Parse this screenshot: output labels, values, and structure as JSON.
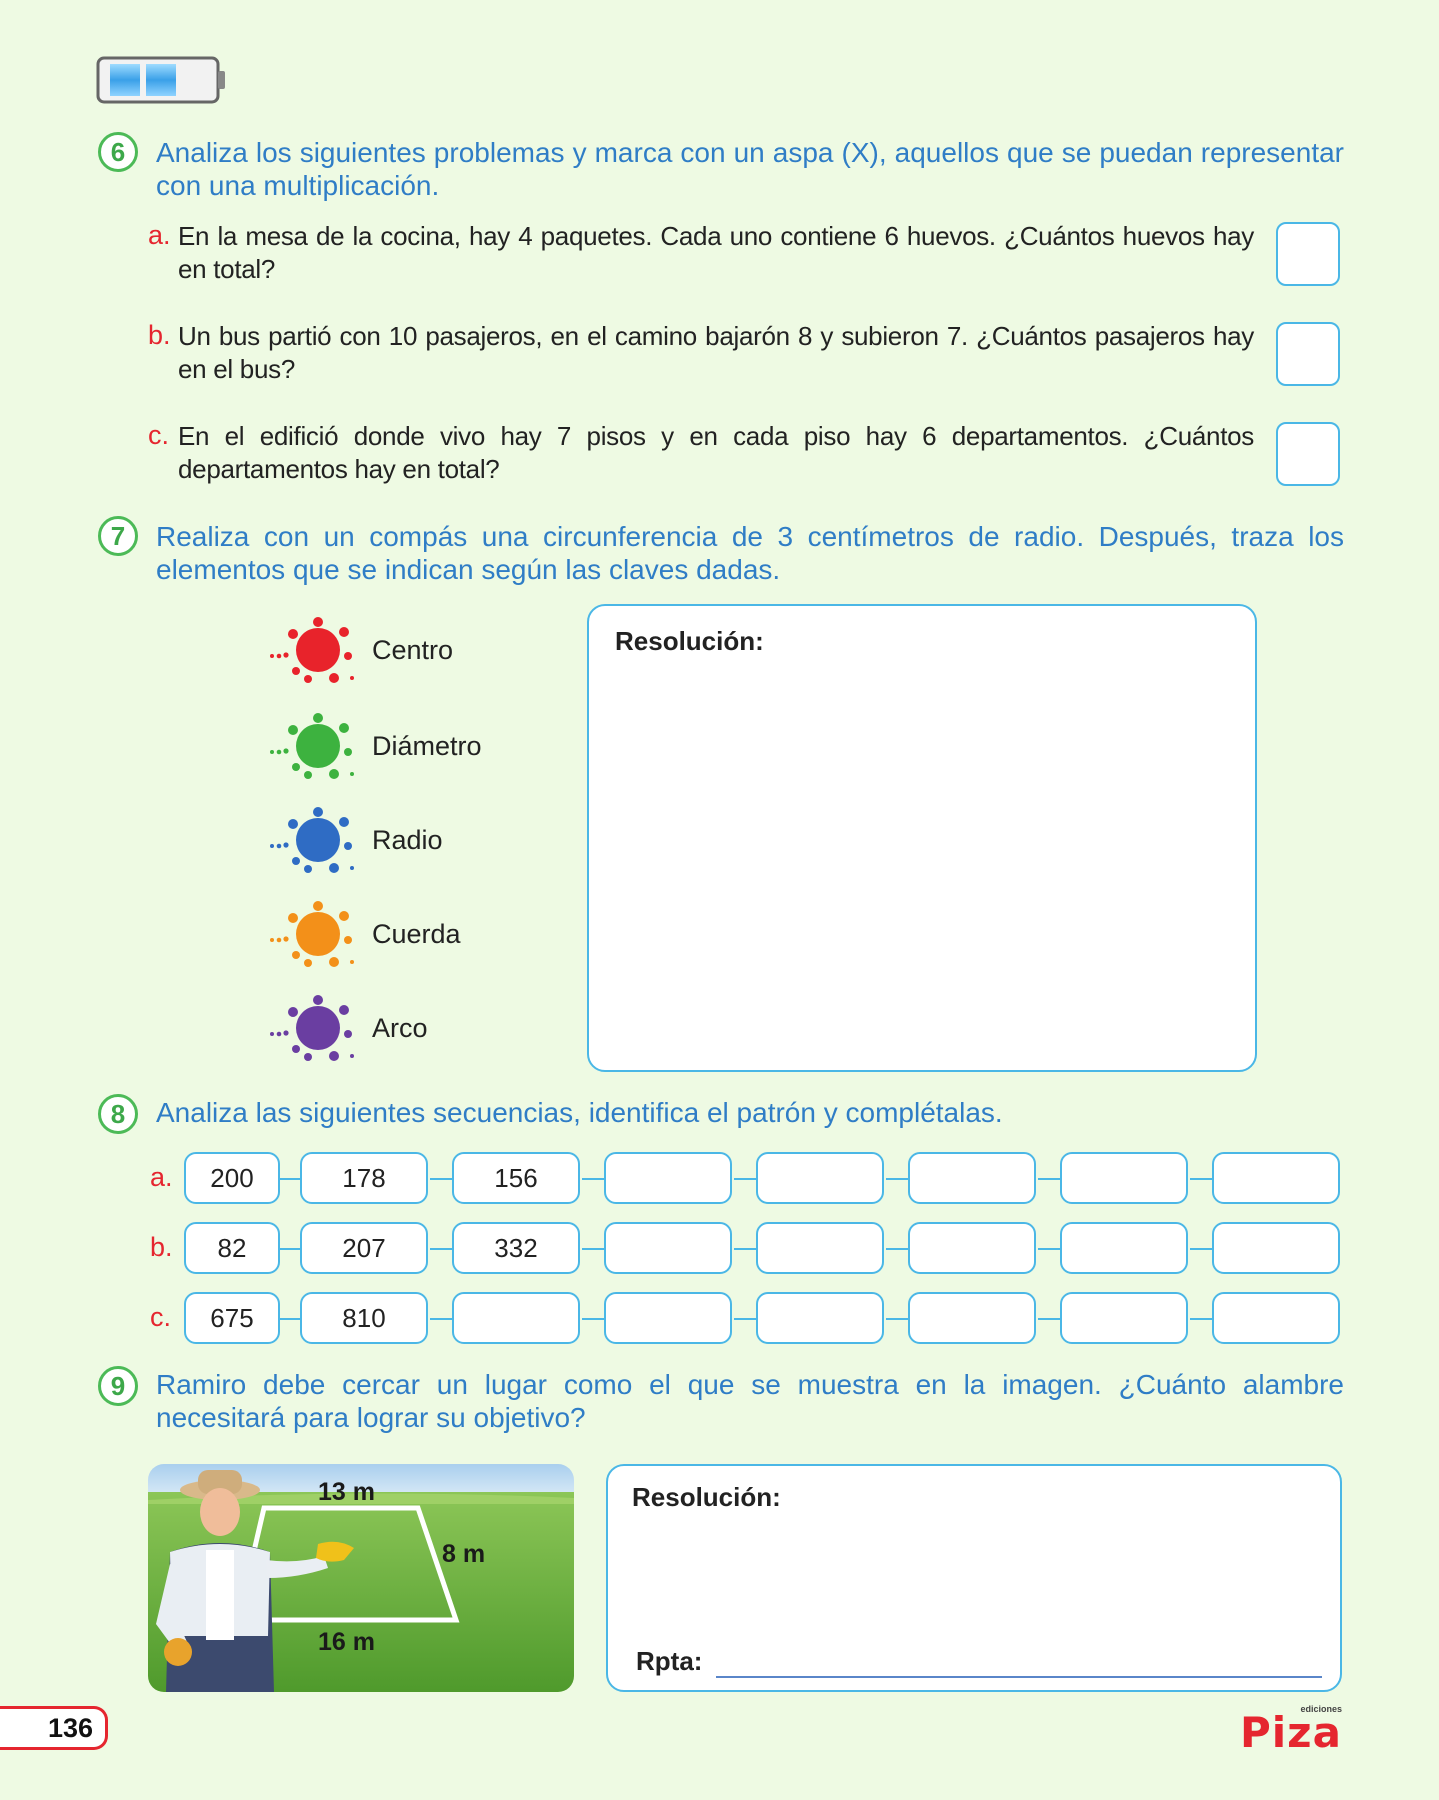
{
  "q6": {
    "number": "6",
    "text": "Analiza los siguientes problemas y marca con un aspa (X), aquellos que se puedan representar con una multiplicación.",
    "items": [
      {
        "letter": "a.",
        "text": "En la mesa de la cocina, hay 4 paquetes. Cada uno contiene 6 huevos. ¿Cuántos huevos hay en total?"
      },
      {
        "letter": "b.",
        "text": "Un bus partió con 10 pasajeros, en el camino bajarón 8 y subieron 7. ¿Cuántos pasajeros hay en el bus?"
      },
      {
        "letter": "c.",
        "text": "En el edifició donde vivo hay 7 pisos y en cada piso hay 6 departamentos. ¿Cuántos departamentos hay en total?"
      }
    ]
  },
  "q7": {
    "number": "7",
    "text": "Realiza con un compás una circunferencia de 3 centímetros de radio. Después, traza los elementos que se indican según las claves dadas.",
    "legend": [
      {
        "label": "Centro",
        "color": "#e8232b"
      },
      {
        "label": "Diámetro",
        "color": "#3db23f"
      },
      {
        "label": "Radio",
        "color": "#2f6cc4"
      },
      {
        "label": "Cuerda",
        "color": "#f39019"
      },
      {
        "label": "Arco",
        "color": "#6a3ea1"
      }
    ],
    "resolution_title": "Resolución:"
  },
  "q8": {
    "number": "8",
    "text": "Analiza las siguientes secuencias, identifica el patrón y complétalas.",
    "rows": [
      {
        "letter": "a.",
        "values": [
          "200",
          "178",
          "156",
          "",
          "",
          "",
          "",
          ""
        ]
      },
      {
        "letter": "b.",
        "values": [
          "82",
          "207",
          "332",
          "",
          "",
          "",
          "",
          ""
        ]
      },
      {
        "letter": "c.",
        "values": [
          "675",
          "810",
          "",
          "",
          "",
          "",
          "",
          ""
        ]
      }
    ]
  },
  "q9": {
    "number": "9",
    "text": "Ramiro debe cercar un lugar como el que se muestra en la imagen. ¿Cuánto alambre necesitará para lograr su objetivo?",
    "dimensions": {
      "top": "13 m",
      "side": "8 m",
      "bottom": "16 m"
    },
    "resolution_title": "Resolución:",
    "answer_label": "Rpta:"
  },
  "footer": {
    "page_number": "136",
    "logo_small": "ediciones",
    "logo": "Piza"
  }
}
